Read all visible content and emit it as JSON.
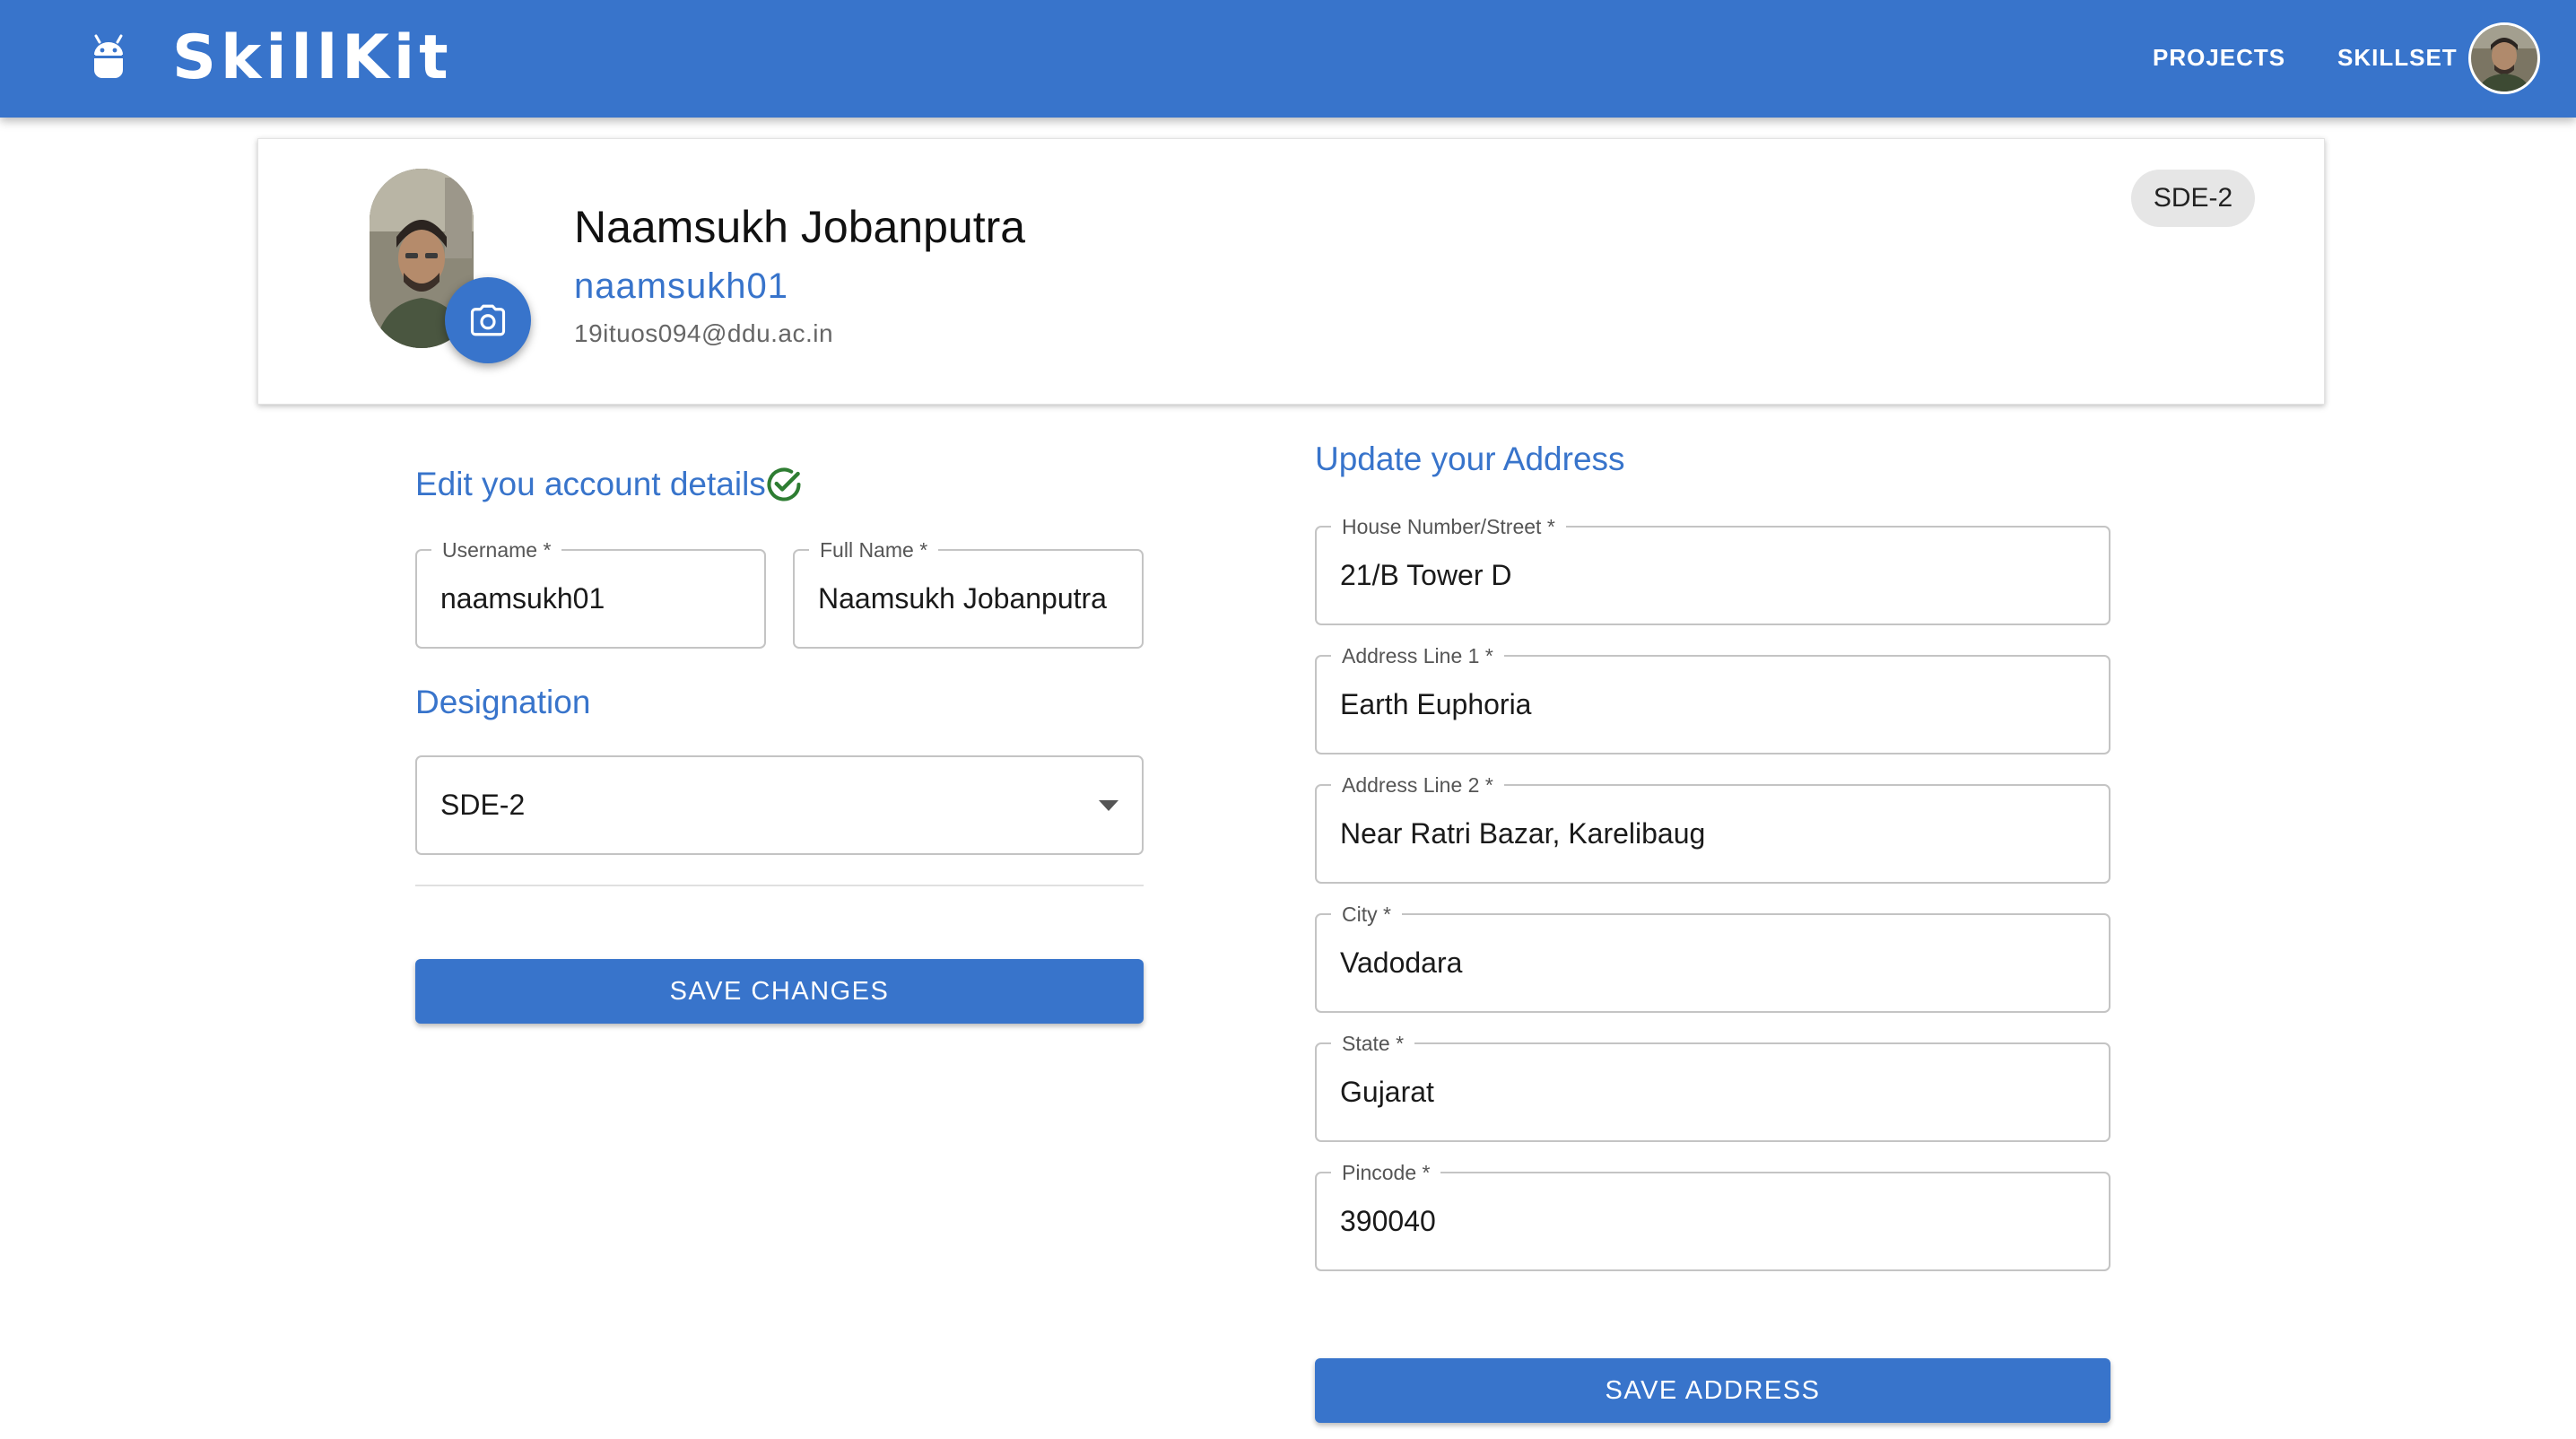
{
  "header": {
    "brand": "SkillKit",
    "nav": {
      "projects": "PROJECTS",
      "skillset": "SKILLSET"
    },
    "brand_icon": "android-icon",
    "bar_color": "#3874cb"
  },
  "profile": {
    "name": "Naamsukh Jobanputra",
    "username": "naamsukh01",
    "email": "19ituos094@ddu.ac.in",
    "designation_chip": "SDE-2",
    "photo_icon": "camera-icon"
  },
  "account": {
    "title": "Edit you account details",
    "username_label": "Username *",
    "username_value": "naamsukh01",
    "fullname_label": "Full Name *",
    "fullname_value": "Naamsukh Jobanputra",
    "designation_title": "Designation",
    "designation_value": "SDE-2",
    "save_button": "SAVE CHANGES"
  },
  "address": {
    "title": "Update your Address",
    "fields": [
      {
        "label": "House Number/Street *",
        "value": "21/B Tower D"
      },
      {
        "label": "Address Line 1 *",
        "value": "Earth Euphoria"
      },
      {
        "label": "Address Line 2 *",
        "value": "Near Ratri Bazar, Karelibaug"
      },
      {
        "label": "City *",
        "value": "Vadodara"
      },
      {
        "label": "State *",
        "value": "Gujarat"
      },
      {
        "label": "Pincode *",
        "value": "390040"
      }
    ],
    "save_button": "SAVE ADDRESS"
  },
  "colors": {
    "accent": "#3874cb",
    "success": "#2e7d32"
  }
}
